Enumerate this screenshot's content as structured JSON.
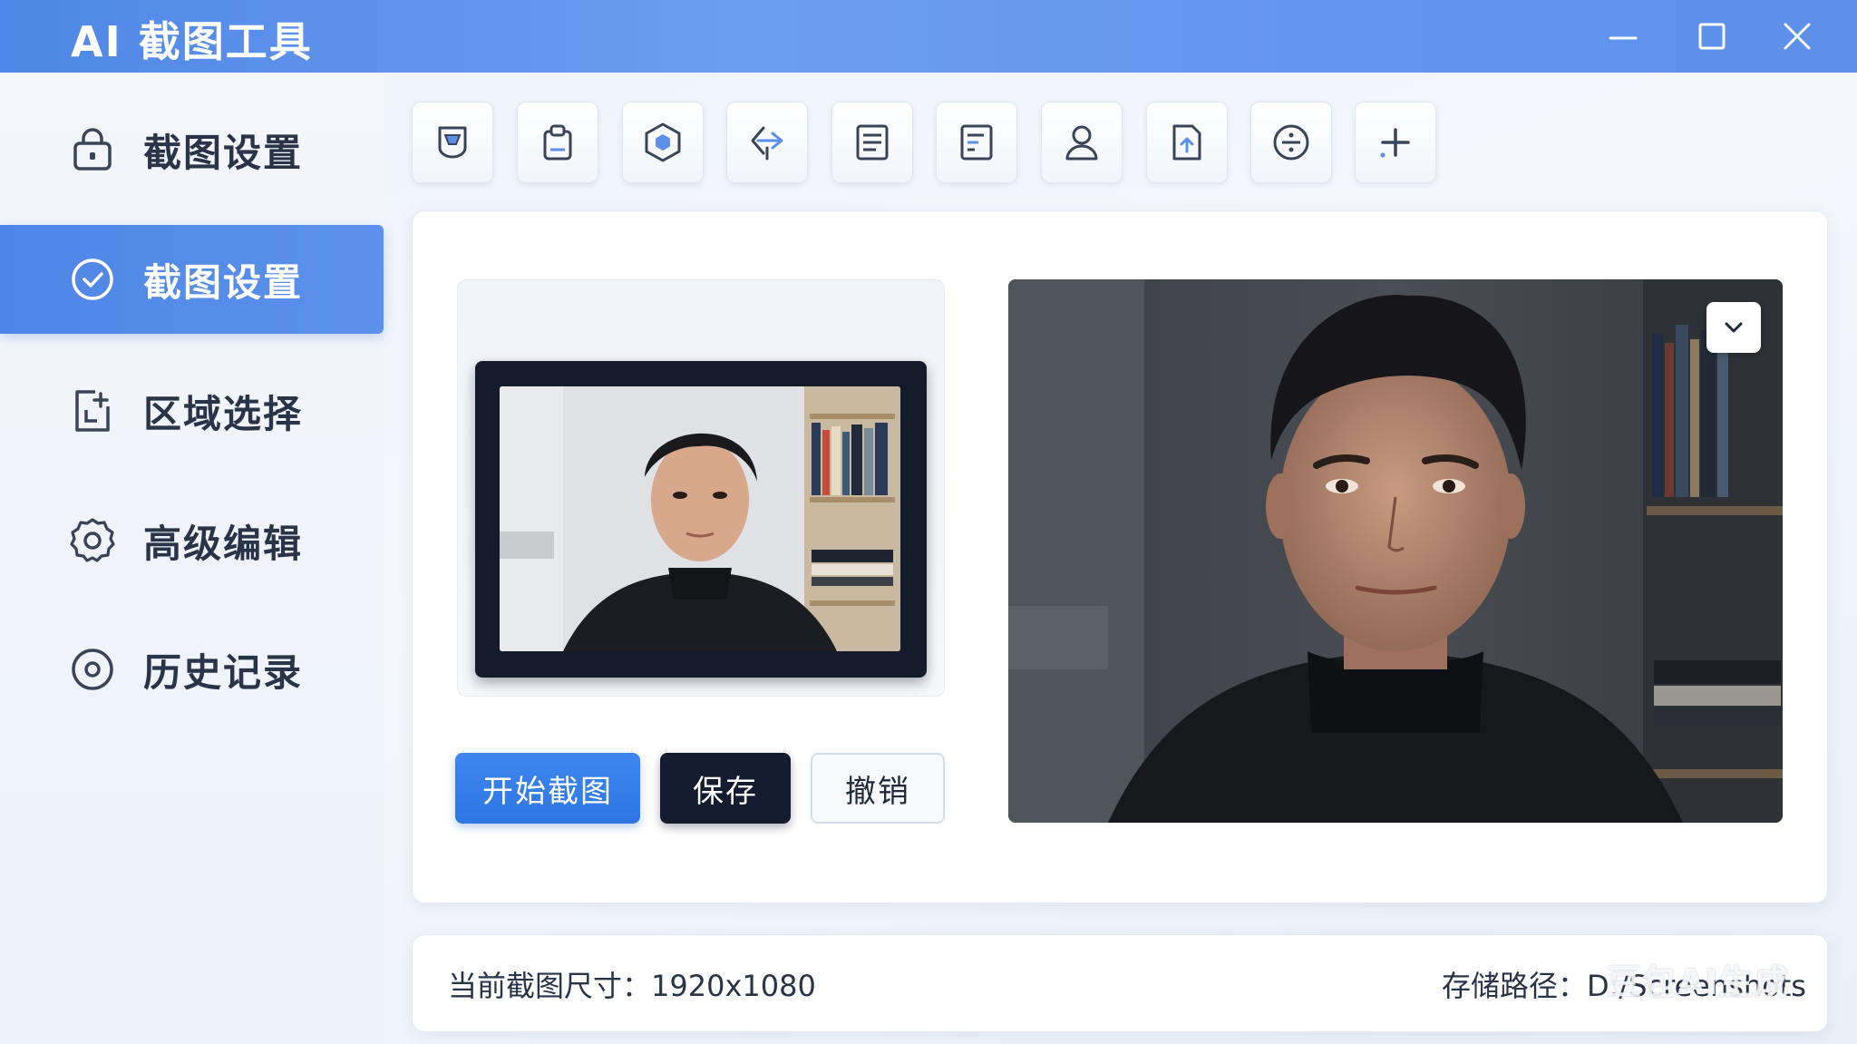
{
  "app": {
    "title": "AI 截图工具"
  },
  "window_controls": [
    "minimize-icon",
    "maximize-icon",
    "close-icon"
  ],
  "sidebar": {
    "items": [
      {
        "label": "截图设置",
        "icon": "lock-icon",
        "active": false
      },
      {
        "label": "截图设置",
        "icon": "check-circle-icon",
        "active": true
      },
      {
        "label": "区域选择",
        "icon": "region-select-icon",
        "active": false
      },
      {
        "label": "高级编辑",
        "icon": "settings-gear-icon",
        "active": false
      },
      {
        "label": "历史记录",
        "icon": "history-icon",
        "active": false
      }
    ]
  },
  "toolbar": {
    "tools": [
      "shield-icon",
      "clipboard-icon",
      "hexagon-icon",
      "share-arrow-icon",
      "document-icon",
      "notes-icon",
      "user-icon",
      "file-upload-icon",
      "divide-circle-icon",
      "add-icon"
    ]
  },
  "actions": {
    "start_label": "开始截图",
    "save_label": "保存",
    "undo_label": "撤销"
  },
  "status": {
    "size_text": "当前截图尺寸：1920x1080",
    "path_text": "存储路径：D:/Screenshots"
  },
  "watermark": "豆包AI生成",
  "colors": {
    "accent": "#3d86f0",
    "titlebar": "#5b8fea",
    "dark_button": "#141d30",
    "sidebar_bg": "#f0f4fa"
  }
}
